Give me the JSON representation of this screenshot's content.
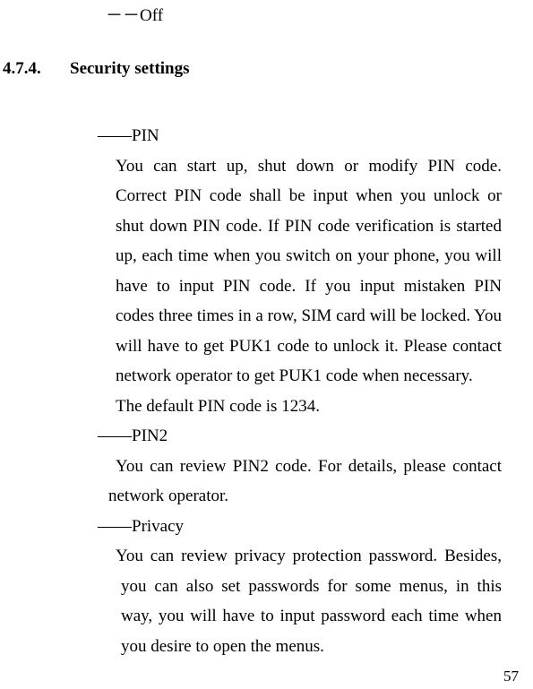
{
  "topLine": "－－Off",
  "section": {
    "number": "4.7.4.",
    "title": "Security settings"
  },
  "items": {
    "pin": {
      "label": "――PIN",
      "para": "You can start up, shut down or modify PIN code. Correct PIN code shall be input when you unlock or shut down PIN code. If PIN code verification is started up, each time when you switch on your phone, you will have to input PIN code. If you input mistaken PIN codes three times in a row, SIM card will be locked. You will have to get PUK1 code to unlock it. Please contact network operator to get PUK1 code when necessary.",
      "defaultLine": "The default PIN code is 1234."
    },
    "pin2": {
      "label": "――PIN2",
      "para": "You can review PIN2 code. For details, please contact network operator."
    },
    "privacy": {
      "label": "――Privacy",
      "para": "You can review privacy protection password. Besides, you can also set passwords for some menus, in this way, you will have to input password each time when you desire to open the menus."
    }
  },
  "pageNumber": "57"
}
